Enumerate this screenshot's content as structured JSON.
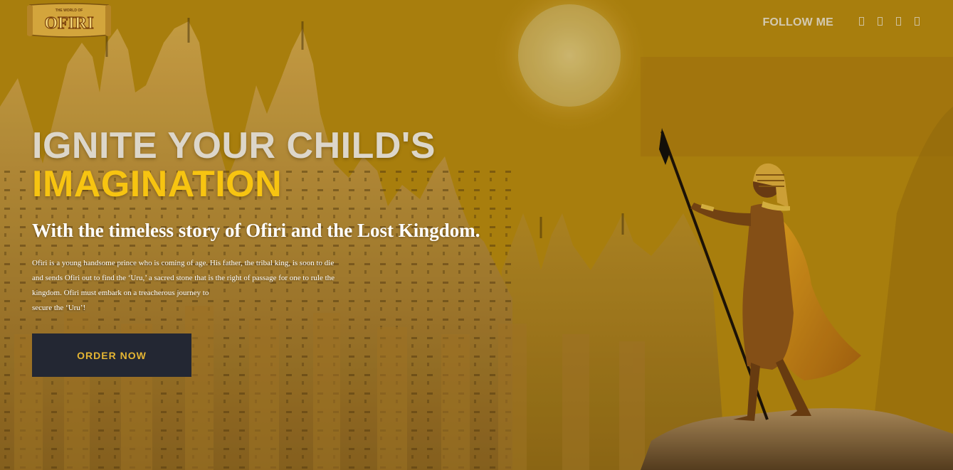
{
  "header": {
    "logo_small_text": "THE WORLD OF",
    "logo_text": "OFIRI",
    "follow_label": "FOLLOW ME",
    "social_icons": [
      "facebook-icon",
      "twitter-icon",
      "instagram-icon",
      "youtube-icon"
    ]
  },
  "hero": {
    "headline_line1": "IGNITE YOUR CHILD'S",
    "headline_line2": "IMAGINATION",
    "subheadline": "With the timeless story of Ofiri and the Lost Kingdom.",
    "description_lines": [
      "Ofiri is a young handsome prince who is coming of age. His father, the tribal king, is soon to die",
      "and sends Ofiri out to find the ‘Uru,’ a sacred stone that is the right of passage for one to rule the",
      "kingdom. Ofiri must embark on a treacherous journey to",
      "secure the ‘Uru’!"
    ],
    "cta_label": "ORDER NOW"
  },
  "colors": {
    "headline_primary": "#dcd6ca",
    "headline_accent": "#f7c411",
    "button_bg": "#232733",
    "button_text": "#e5b533",
    "sky": "#b8880f"
  }
}
